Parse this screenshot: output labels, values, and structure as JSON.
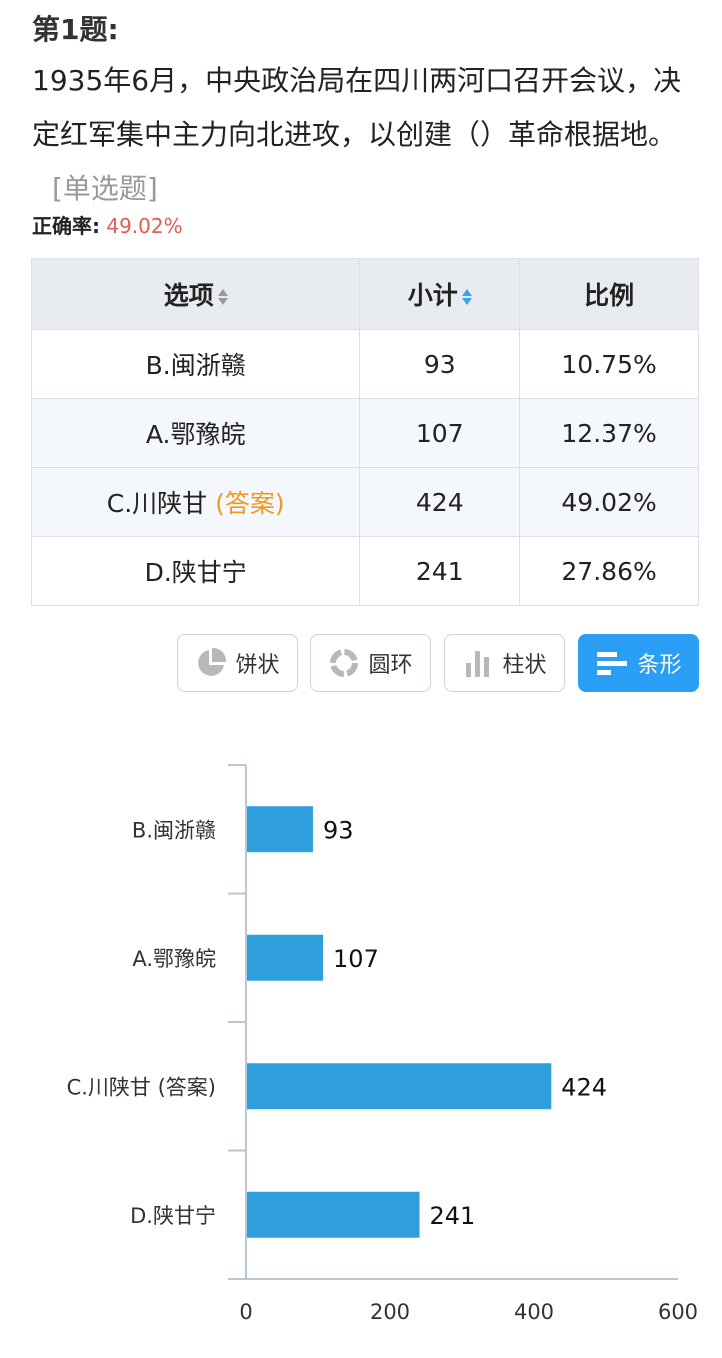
{
  "question": {
    "title": "第1题:",
    "text": "1935年6月，中央政治局在四川两河口召开会议，决定红军集中主力向北进攻，以创建（）革命根据地。",
    "type": "[单选题]"
  },
  "accuracy": {
    "label": "正确率:",
    "value": "49.02%"
  },
  "table": {
    "headers": [
      "选项",
      "小计",
      "比例"
    ],
    "rows": [
      {
        "option": "B.闽浙赣",
        "answer": "",
        "count": "93",
        "ratio": "10.75%"
      },
      {
        "option": "A.鄂豫皖",
        "answer": "",
        "count": "107",
        "ratio": "12.37%"
      },
      {
        "option": "C.川陕甘",
        "answer": "(答案)",
        "count": "424",
        "ratio": "49.02%"
      },
      {
        "option": "D.陕甘宁",
        "answer": "",
        "count": "241",
        "ratio": "27.86%"
      }
    ]
  },
  "chart_buttons": [
    {
      "label": "饼状",
      "icon": "pie-icon",
      "active": false
    },
    {
      "label": "圆环",
      "icon": "ring-icon",
      "active": false
    },
    {
      "label": "柱状",
      "icon": "column-icon",
      "active": false
    },
    {
      "label": "条形",
      "icon": "bar-icon",
      "active": true
    }
  ],
  "colors": {
    "bar": "#2e9fdc",
    "active_button": "#2a9df4",
    "answer": "#ef9a1f",
    "accuracy": "#e45b52"
  },
  "chart_data": {
    "type": "bar",
    "orientation": "horizontal",
    "categories": [
      "B.闽浙赣",
      "A.鄂豫皖",
      "C.川陕甘 (答案)",
      "D.陕甘宁"
    ],
    "values": [
      93,
      107,
      424,
      241
    ],
    "xlim": [
      0,
      600
    ],
    "xticks": [
      0,
      200,
      400,
      600
    ],
    "grid": false
  }
}
